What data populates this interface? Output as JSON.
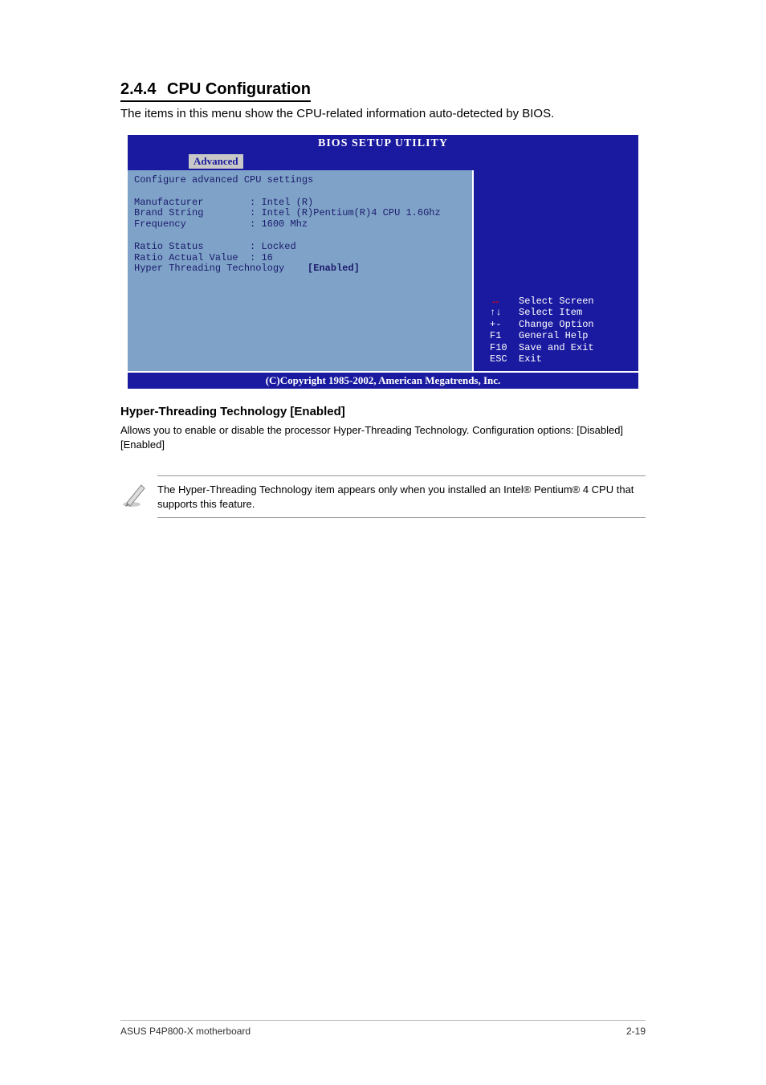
{
  "section": {
    "number": "2.4.4",
    "title": "CPU Configuration",
    "description": "The items in this menu show the CPU-related information auto-detected by BIOS."
  },
  "bios": {
    "title": "BIOS SETUP UTILITY",
    "tab": "Advanced",
    "heading": "Configure advanced CPU settings",
    "fields": {
      "manufacturer_label": "Manufacturer",
      "manufacturer_value": "Intel (R)",
      "brand_label": "Brand String",
      "brand_value": "Intel (R)Pentium(R)4 CPU 1.6Ghz",
      "freq_label": "Frequency",
      "freq_value": "1600 Mhz",
      "ratio_status_label": "Ratio Status",
      "ratio_status_value": "Locked",
      "ratio_actual_label": "Ratio Actual Value",
      "ratio_actual_value": "16",
      "ht_label": "Hyper Threading Technology",
      "ht_value": "[Enabled]"
    },
    "nav": {
      "screen": "Select Screen",
      "item": "Select Item",
      "change_key": "+-",
      "change": "Change Option",
      "help_key": "F1",
      "help": "General Help",
      "save_key": "F10",
      "save": "Save and Exit",
      "exit_key": "ESC",
      "exit": "Exit"
    },
    "footer": "(C)Copyright 1985-2002, American Megatrends, Inc."
  },
  "option": {
    "title": "Hyper-Threading Technology [Enabled]",
    "body": "Allows you to enable or disable the processor Hyper-Threading Technology. Configuration options: [Disabled] [Enabled]"
  },
  "note": {
    "text": "The Hyper-Threading Technology item appears only when you installed an Intel® Pentium® 4 CPU that supports this feature."
  },
  "footer": {
    "left": "ASUS P4P800-X motherboard",
    "right": "2-19"
  }
}
